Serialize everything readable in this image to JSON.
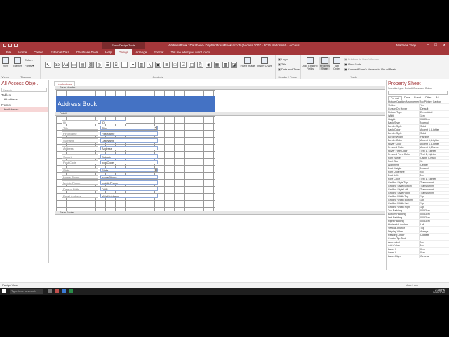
{
  "window": {
    "context_tab": "Form Design Tools",
    "title": "AddressBook : Database- D:\\pt\\AddressBook.accdb (Access 2007 - 2016 file format) - Access",
    "user": "Matthew Tapp",
    "min": "–",
    "max": "□",
    "close": "✕"
  },
  "ribbon_tabs": [
    "File",
    "Home",
    "Create",
    "External Data",
    "Database Tools",
    "Help",
    "Design",
    "Arrange",
    "Format",
    "Tell me what you want to do"
  ],
  "active_tab_index": 6,
  "ribbon": {
    "views": {
      "view_label": "View",
      "group": "Views"
    },
    "themes": {
      "themes_label": "Themes",
      "colors_label": "Colors",
      "fonts_label": "Fonts",
      "group": "Themes"
    },
    "controls": {
      "group": "Controls",
      "insert_image": "Insert Image",
      "insert_chart": "Insert Chart"
    },
    "header_footer": {
      "logo": "Logo",
      "title": "Title",
      "date_time": "Date and Time",
      "group": "Header / Footer"
    },
    "tools": {
      "add_existing": "Add Existing Fields",
      "property_sheet": "Property Sheet",
      "tab_order": "Tab Order",
      "subform": "Subform in New Window",
      "view_code": "View Code",
      "convert_macros": "Convert Form's Macros to Visual Basic",
      "group": "Tools"
    }
  },
  "nav": {
    "title": "All Access Obje...",
    "search_placeholder": "Search...",
    "tables_label": "Tables",
    "tables": [
      "tblAddress"
    ],
    "forms_label": "Forms",
    "forms": [
      "frmAddress"
    ]
  },
  "document": {
    "tab_label": "frmAddress",
    "form_header_label": "Form Header",
    "detail_label": "Detail",
    "form_footer_label": "Form Footer",
    "title": "Address Book",
    "fields": [
      {
        "label": "ID",
        "control": "ID"
      },
      {
        "label": "Title",
        "control": "Title"
      },
      {
        "label": "First Name",
        "control": "FirstName"
      },
      {
        "label": "Surname",
        "control": "LastName"
      },
      {
        "label": "Address",
        "control": "Address"
      },
      {
        "label": "Suburb",
        "control": "Suburb"
      },
      {
        "label": "Post Code",
        "control": "postCode"
      },
      {
        "label": "State",
        "control": "State"
      },
      {
        "label": "Home Phone",
        "control": "homePhone"
      },
      {
        "label": "Mobile Phone",
        "control": "mobilePhone"
      },
      {
        "label": "Date of Birth",
        "control": "DOB"
      },
      {
        "label": "Email Address",
        "control": "eMailAddress"
      }
    ]
  },
  "property_sheet": {
    "title": "Property Sheet",
    "selection_type": "Selection type: Default Command Button",
    "tabs": [
      "Format",
      "Data",
      "Event",
      "Other",
      "All"
    ],
    "rows": [
      [
        "Picture Caption Arrangement",
        "No Picture Caption"
      ],
      [
        "Visible",
        "Yes"
      ],
      [
        "Cursor On Hover",
        "Default"
      ],
      [
        "Picture Type",
        "Embedded"
      ],
      [
        "Width",
        "1cm"
      ],
      [
        "Height",
        "0.635cm"
      ],
      [
        "Back Style",
        "Normal"
      ],
      [
        "Border Style",
        "Solid"
      ],
      [
        "Back Color",
        "Accent 1, Lighter"
      ],
      [
        "Border Style",
        "Solid"
      ],
      [
        "Border Width",
        "Hairline"
      ],
      [
        "Border Color",
        "Accent 1, Lighter"
      ],
      [
        "Hover Color",
        "Accent 1, Lighter"
      ],
      [
        "Pressed Color",
        "Accent 1, Darker"
      ],
      [
        "Hover Fore Color",
        "Text 1, Lighter"
      ],
      [
        "Pressed Fore Color",
        "Text 1, Lighter"
      ],
      [
        "Font Name",
        "Calibri (Detail)"
      ],
      [
        "Font Size",
        "11"
      ],
      [
        "Alignment",
        "Center"
      ],
      [
        "Font Weight",
        "Normal"
      ],
      [
        "Font Underline",
        "No"
      ],
      [
        "Font Italic",
        "No"
      ],
      [
        "Fore Color",
        "Text 1, Lighter"
      ],
      [
        "Gridline Style Top",
        "Transparent"
      ],
      [
        "Gridline Style Bottom",
        "Transparent"
      ],
      [
        "Gridline Style Left",
        "Transparent"
      ],
      [
        "Gridline Style Right",
        "Transparent"
      ],
      [
        "Gridline Width Top",
        "1 pt"
      ],
      [
        "Gridline Width Bottom",
        "1 pt"
      ],
      [
        "Gridline Width Left",
        "1 pt"
      ],
      [
        "Gridline Width Right",
        "1 pt"
      ],
      [
        "Top Padding",
        "0.053cm"
      ],
      [
        "Bottom Padding",
        "0.053cm"
      ],
      [
        "Left Padding",
        "0.053cm"
      ],
      [
        "Right Padding",
        "0.053cm"
      ],
      [
        "Horizontal Anchor",
        "Left"
      ],
      [
        "Vertical Anchor",
        "Top"
      ],
      [
        "Display When",
        "Always"
      ],
      [
        "Reading Order",
        "Context"
      ],
      [
        "Control Tip Text",
        ""
      ],
      [
        "Auto Label",
        "No"
      ],
      [
        "Add Colon",
        "No"
      ],
      [
        "Label X",
        "0cm"
      ],
      [
        "Label Y",
        "0cm"
      ],
      [
        "Label Align",
        "General"
      ]
    ]
  },
  "status": {
    "left": "Design View",
    "right": "Num Lock"
  },
  "taskbar": {
    "search": "Type here to search",
    "time": "2:38 PM",
    "date": "5/30/2020"
  }
}
